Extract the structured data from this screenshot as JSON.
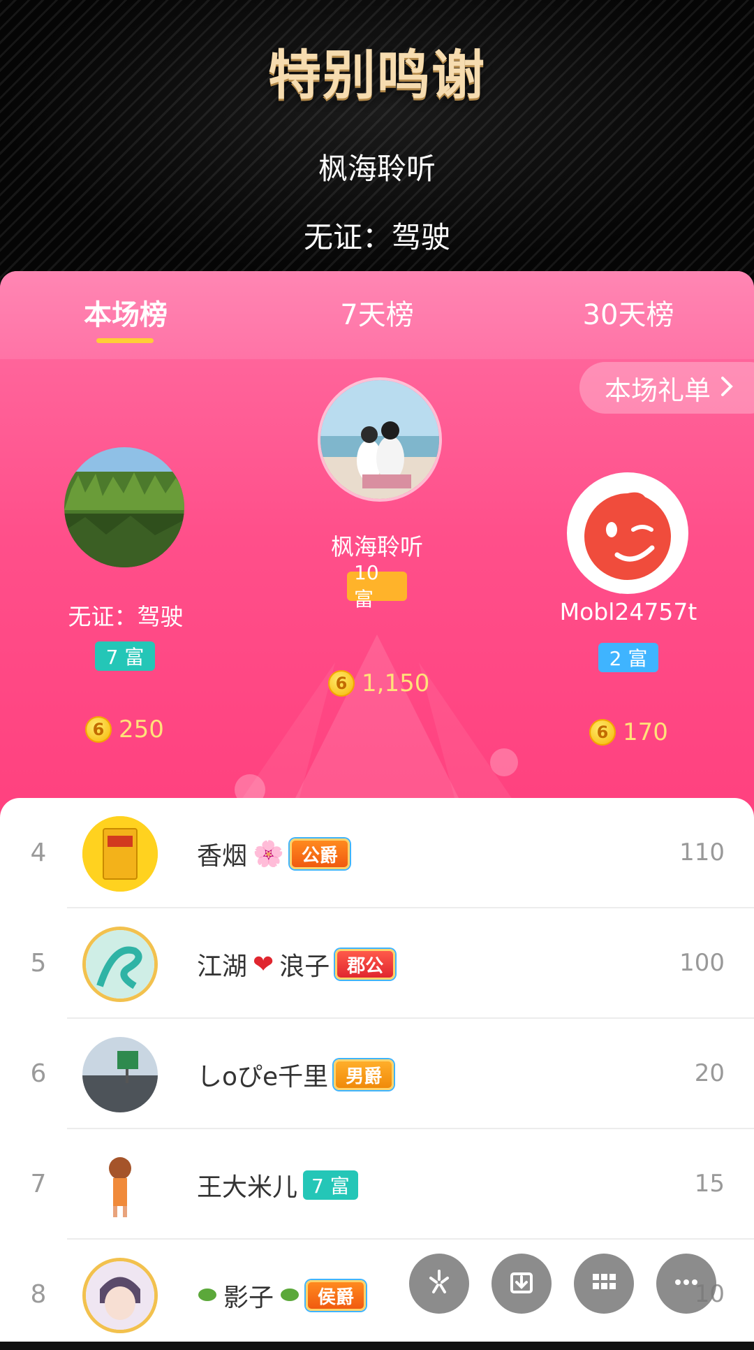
{
  "banner": {
    "title": "特别鸣谢",
    "line1": "枫海聆听",
    "line2": "无证：驾驶"
  },
  "tabs": [
    {
      "label": "本场榜",
      "active": true
    },
    {
      "label": "7天榜",
      "active": false
    },
    {
      "label": "30天榜",
      "active": false
    }
  ],
  "gift_list_button": {
    "label": "本场礼单",
    "icon": "chevron-right-icon"
  },
  "top3": {
    "first": {
      "name": "枫海聆听",
      "wealth": "10 富",
      "coins": "1,150",
      "podium": "1"
    },
    "second": {
      "name": "无证：驾驶",
      "wealth": "7 富",
      "coins": "250",
      "podium": "2"
    },
    "third": {
      "name": "Mobl24757t",
      "wealth": "2 富",
      "coins": "170",
      "podium": "3"
    }
  },
  "coin_symbol": "6",
  "ranks": [
    {
      "rank": "4",
      "name": "香烟",
      "emoji": "🌸",
      "tag": "公爵",
      "score": "110"
    },
    {
      "rank": "5",
      "name_a": "江湖",
      "heart": "❤",
      "name_b": "浪子",
      "tag": "郡公",
      "score": "100"
    },
    {
      "rank": "6",
      "name": "しoぴe千里",
      "tag": "男爵",
      "score": "20"
    },
    {
      "rank": "7",
      "name": "王大米儿",
      "tag": "7 富",
      "score": "15"
    },
    {
      "rank": "8",
      "name": "影子",
      "tag": "侯爵",
      "score": "10"
    }
  ],
  "colors": {
    "accent_pink": "#ff4f8a",
    "gold": "#ffce36",
    "teal": "#24c6b7",
    "blue": "#3fb4ff"
  },
  "fab_icons": [
    "share-icon",
    "download-icon",
    "grid-icon",
    "more-icon"
  ]
}
